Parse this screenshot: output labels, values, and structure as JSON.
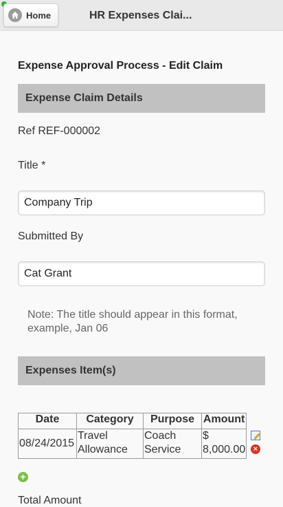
{
  "header": {
    "home_label": "Home",
    "title": "HR Expenses Clai..."
  },
  "page": {
    "heading": "Expense Approval Process - Edit Claim"
  },
  "claim_details": {
    "section_title": "Expense Claim Details",
    "ref_text": "Ref REF-000002",
    "title_label": "Title *",
    "title_value": "Company Trip",
    "submitted_by_label": "Submitted By",
    "submitted_by_value": "Cat Grant",
    "note": "Note: The title should appear in this format, example, Jan 06"
  },
  "expenses": {
    "section_title": "Expenses Item(s)",
    "columns": [
      "Date",
      "Category",
      "Purpose",
      "Amount"
    ],
    "rows": [
      {
        "date": "08/24/2015",
        "category": "Travel Allowance",
        "purpose": "Coach Service",
        "amount": "$ 8,000.00"
      }
    ],
    "total_label": "Total Amount"
  },
  "colors": {
    "section_bar": "#c1c1c1",
    "header_bg": "#e9e9e9",
    "status_dot": "#2fb52f",
    "add_icon": "#7ac143",
    "delete_icon": "#d9341f"
  },
  "icons": {
    "home": "home-icon",
    "edit": "edit-icon",
    "delete": "delete-icon",
    "add": "add-icon"
  }
}
